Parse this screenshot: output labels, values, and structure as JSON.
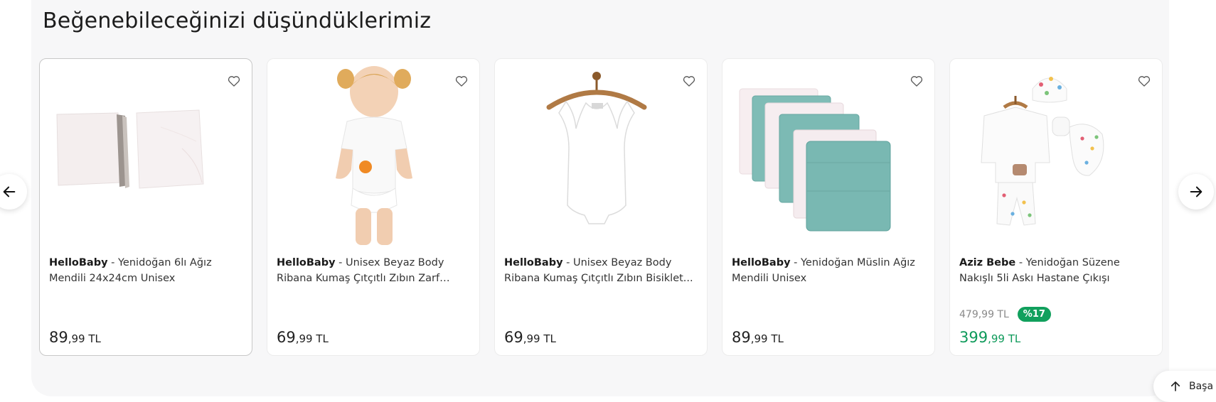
{
  "section": {
    "title": "Beğenebileceğinizi düşündüklerimiz"
  },
  "products": [
    {
      "brand": "HelloBaby",
      "name": " - Yenidoğan 6lı Ağız Mendili 24x24cm Unisex",
      "price_int": "89",
      "price_dec": ",99 TL"
    },
    {
      "brand": "HelloBaby",
      "name": " - Unisex Beyaz Body Ribana Kumaş Çıtçıtlı Zıbın Zarf Yaka...",
      "price_int": "69",
      "price_dec": ",99 TL"
    },
    {
      "brand": "HelloBaby",
      "name": " - Unisex Beyaz Body Ribana Kumaş Çıtçıtlı Zıbın Bisiklet...",
      "price_int": "69",
      "price_dec": ",99 TL"
    },
    {
      "brand": "HelloBaby",
      "name": " - Yenidoğan Müslin Ağız Mendili Unisex",
      "price_int": "89",
      "price_dec": ",99 TL"
    },
    {
      "brand": "Aziz Bebe",
      "name": " - Yenidoğan Süzene Nakışlı 5li Askı Hastane Çıkışı",
      "old_price": "479,99 TL",
      "discount": "%17",
      "price_int": "399",
      "price_dec": ",99 TL"
    }
  ],
  "back_to_top": {
    "label": "Başa"
  },
  "icons": {
    "favorite": "heart-icon",
    "prev": "arrow-left-icon",
    "next": "arrow-right-icon",
    "up": "arrow-up-icon"
  },
  "colors": {
    "sale": "#0e9a5a",
    "badge": "#11a05d"
  }
}
